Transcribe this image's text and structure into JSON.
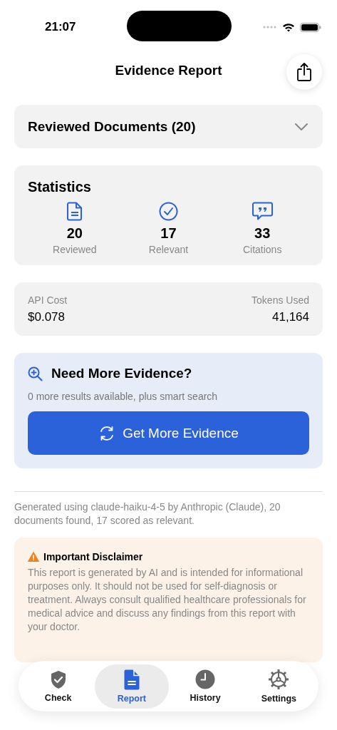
{
  "status_bar": {
    "time": "21:07"
  },
  "header": {
    "title": "Evidence Report"
  },
  "documents": {
    "title": "Reviewed Documents (20)",
    "expanded": false
  },
  "statistics": {
    "title": "Statistics",
    "items": [
      {
        "kind": "document",
        "value": "20",
        "label": "Reviewed"
      },
      {
        "kind": "check",
        "value": "17",
        "label": "Relevant"
      },
      {
        "kind": "quote",
        "value": "33",
        "label": "Citations"
      }
    ]
  },
  "usage": {
    "cost_label": "API Cost",
    "cost": "$0.078",
    "tokens_label": "Tokens Used",
    "tokens": "41,164"
  },
  "more_evidence": {
    "title": "Need More Evidence?",
    "subtitle": "0 more results available, plus smart search",
    "button": "Get More Evidence"
  },
  "footnote": "Generated using claude-haiku-4-5 by Anthropic (Claude), 20 documents found, 17 scored as relevant.",
  "disclaimer": {
    "title": "Important Disclaimer",
    "text": "This report is generated by AI and is intended for informational purposes only. It should not be used for self-diagnosis or treatment. Always consult qualified healthcare professionals for medical advice and discuss any findings from this report with your doctor."
  },
  "tabs": [
    {
      "kind": "check",
      "label": "Check",
      "selected": false
    },
    {
      "kind": "report",
      "label": "Report",
      "selected": true
    },
    {
      "kind": "history",
      "label": "History",
      "selected": false
    },
    {
      "kind": "settings",
      "label": "Settings",
      "selected": false
    }
  ]
}
